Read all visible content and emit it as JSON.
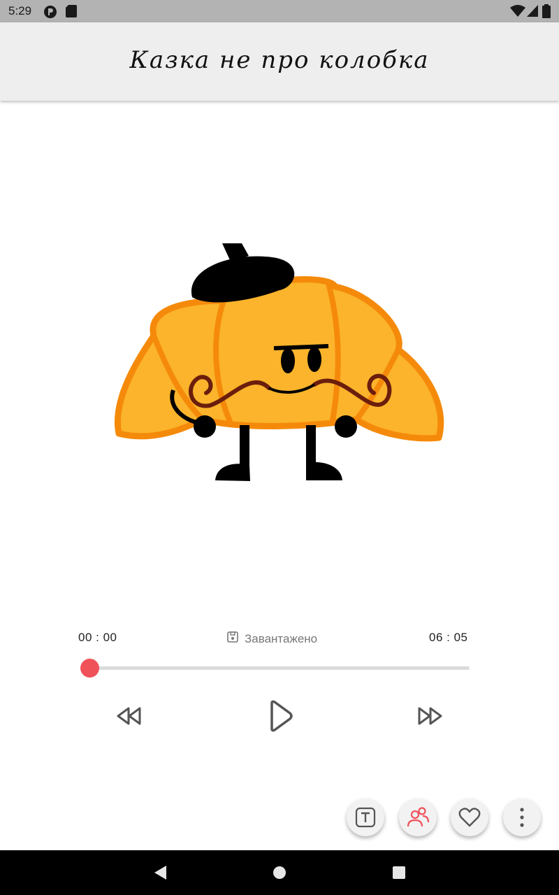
{
  "status_bar": {
    "time": "5:29"
  },
  "app_bar": {
    "title": "Казка не про колобка"
  },
  "player": {
    "elapsed": "00 : 00",
    "total": "06 : 05",
    "download_status": "Завантажено",
    "progress": 0,
    "accent_color": "#f0525a"
  },
  "actions": [
    {
      "icon": "text-icon"
    },
    {
      "icon": "characters-icon"
    },
    {
      "icon": "heart-icon"
    },
    {
      "icon": "more-vert-icon"
    }
  ],
  "nav": {
    "back": "back-icon",
    "home": "home-icon",
    "recents": "recents-icon"
  }
}
